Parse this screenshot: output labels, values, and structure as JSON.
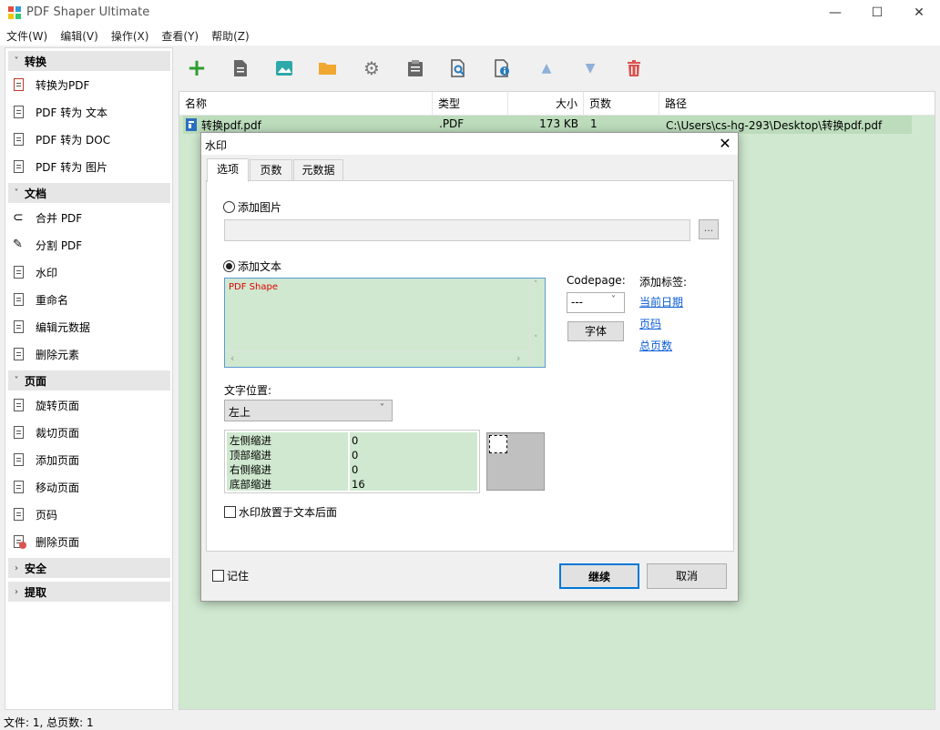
{
  "app": {
    "title": "PDF Shaper Ultimate"
  },
  "window_controls": {
    "minimize": "—",
    "maximize": "☐",
    "close": "✕"
  },
  "menu": [
    "文件(W)",
    "编辑(V)",
    "操作(X)",
    "查看(Y)",
    "帮助(Z)"
  ],
  "sidebar": {
    "sections": [
      {
        "label": "转换",
        "expanded": true,
        "items": [
          "转换为PDF",
          "PDF 转为 文本",
          "PDF 转为 DOC",
          "PDF 转为 图片"
        ]
      },
      {
        "label": "文档",
        "expanded": true,
        "items": [
          "合并 PDF",
          "分割 PDF",
          "水印",
          "重命名",
          "编辑元数据",
          "删除元素"
        ]
      },
      {
        "label": "页面",
        "expanded": true,
        "items": [
          "旋转页面",
          "裁切页面",
          "添加页面",
          "移动页面",
          "页码",
          "删除页面"
        ]
      },
      {
        "label": "安全",
        "expanded": false,
        "items": []
      },
      {
        "label": "提取",
        "expanded": false,
        "items": []
      }
    ]
  },
  "toolbar": {
    "icons": [
      "add-icon",
      "document-icon",
      "image-icon",
      "folder-icon",
      "settings-icon",
      "clipboard-icon",
      "search-icon",
      "info-icon",
      "arrow-up-icon",
      "arrow-down-icon",
      "delete-icon"
    ]
  },
  "file_list": {
    "columns": [
      "名称",
      "类型",
      "大小",
      "页数",
      "路径"
    ],
    "rows": [
      {
        "name": "转换pdf.pdf",
        "type": ".PDF",
        "size": "173 KB",
        "pages": "1",
        "path": "C:\\Users\\cs-hg-293\\Desktop\\转换pdf.pdf"
      }
    ]
  },
  "status": {
    "text": "文件: 1, 总页数: 1"
  },
  "dialog": {
    "title": "水印",
    "close": "✕",
    "tabs": [
      "选项",
      "页数",
      "元数据"
    ],
    "add_image_label": "添加图片",
    "image_path": "",
    "browse_label": "...",
    "add_text_label": "添加文本",
    "watermark_text": "PDF Shape",
    "codepage_label": "Codepage:",
    "codepage_value": "---",
    "font_button": "字体",
    "tags_label": "添加标签:",
    "tags": [
      "当前日期",
      "页码",
      "总页数"
    ],
    "position_label": "文字位置:",
    "position_value": "左上",
    "indents": [
      {
        "label": "左侧缩进",
        "value": "0"
      },
      {
        "label": "顶部缩进",
        "value": "0"
      },
      {
        "label": "右侧缩进",
        "value": "0"
      },
      {
        "label": "底部缩进",
        "value": "16"
      }
    ],
    "behind_text_label": "水印放置于文本后面",
    "remember_label": "记住",
    "continue_button": "继续",
    "cancel_button": "取消"
  },
  "colors": {
    "accent_green": "#cfe8cf",
    "link": "#0b5ed7",
    "delete_red": "#d9534f",
    "text_red": "#e00000"
  }
}
